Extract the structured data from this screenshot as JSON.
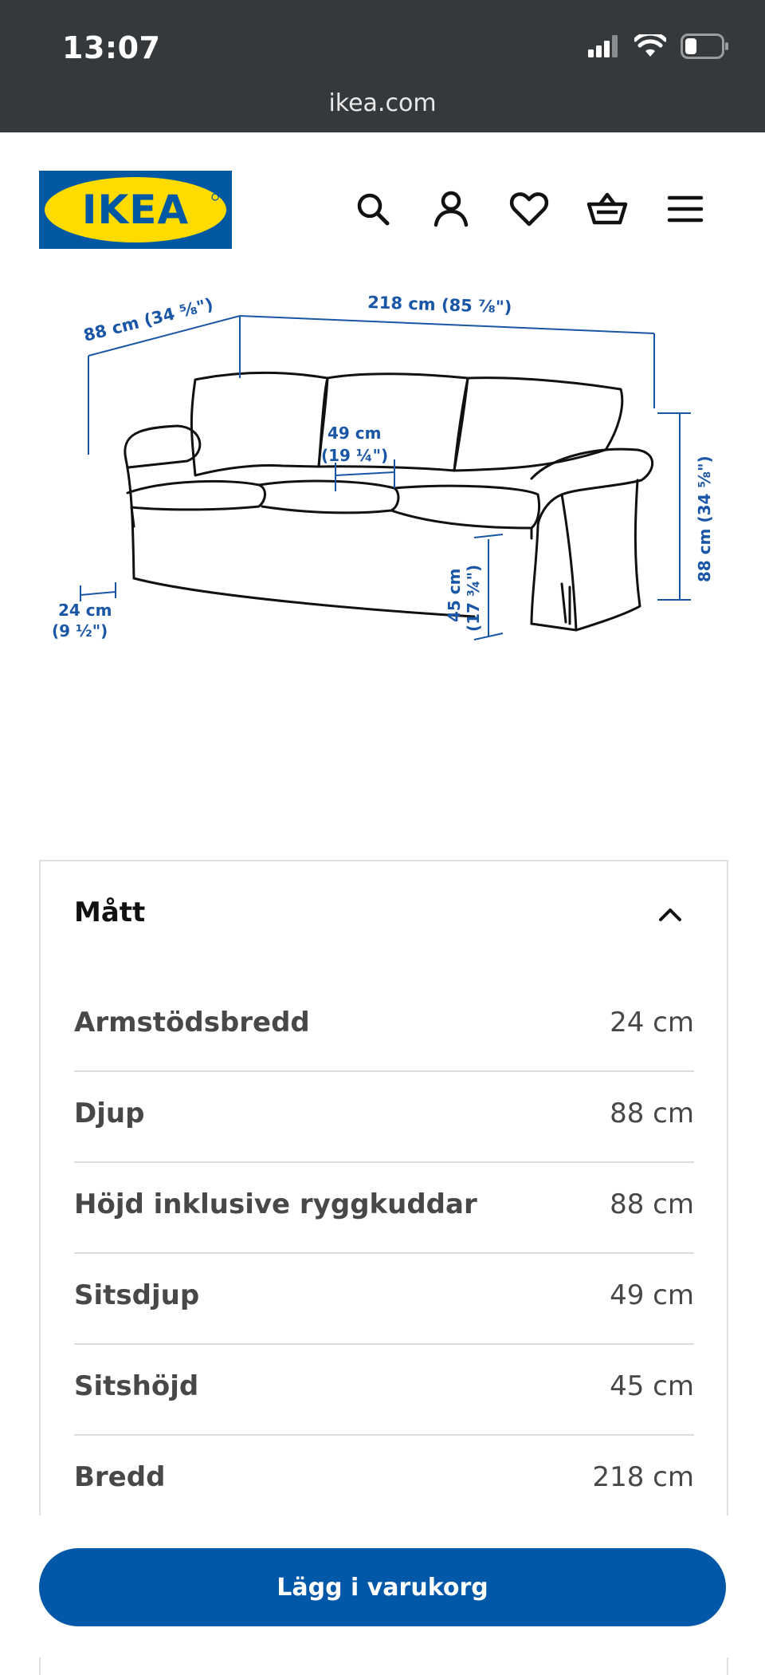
{
  "status_bar": {
    "time": "13:07",
    "url": "ikea.com",
    "icons": [
      "signal-icon",
      "wifi-icon",
      "battery-icon"
    ]
  },
  "header": {
    "logo_text": "IKEA",
    "icons": [
      "search-icon",
      "account-icon",
      "heart-icon",
      "cart-icon",
      "menu-icon"
    ],
    "brand_blue": "#0058a3",
    "brand_yellow": "#ffdb00"
  },
  "diagram": {
    "labels": {
      "depth_top": "88 cm (34 ⅝\")",
      "width": "218 cm (85 ⅞\")",
      "seat_depth_cm": "49 cm",
      "seat_depth_in": "(19 ¼\")",
      "height_side": "88 cm (34 ⅝\")",
      "seat_height_cm": "45 cm",
      "seat_height_in": "(17 ¾\")",
      "arm_cm": "24 cm",
      "arm_in": "(9 ½\")"
    },
    "label_color": "#1a56a6"
  },
  "dimensions": {
    "title": "Mått",
    "rows": [
      {
        "label": "Armstödsbredd",
        "value": "24 cm"
      },
      {
        "label": "Djup",
        "value": "88 cm"
      },
      {
        "label": "Höjd inklusive ryggkuddar",
        "value": "88 cm"
      },
      {
        "label": "Sitsdjup",
        "value": "49 cm"
      },
      {
        "label": "Sitshöjd",
        "value": "45 cm"
      },
      {
        "label": "Bredd",
        "value": "218 cm"
      }
    ]
  },
  "cta": {
    "label": "Lägg i varukorg",
    "color": "#0157a8"
  }
}
